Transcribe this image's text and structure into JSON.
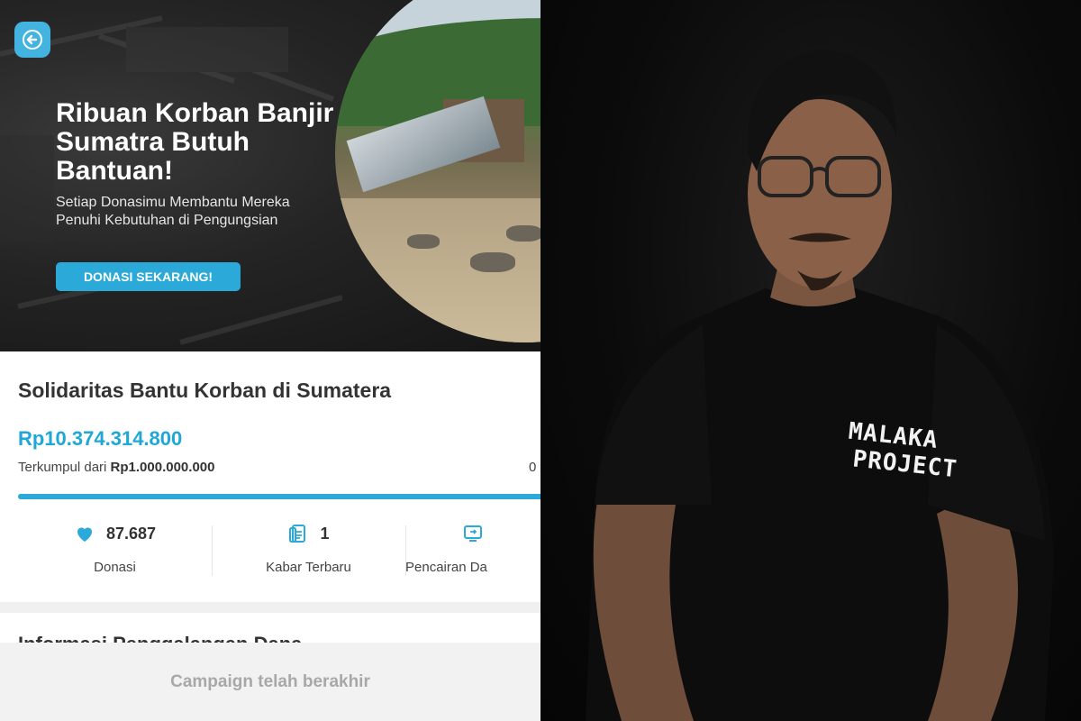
{
  "banner": {
    "headline": "Ribuan Korban Banjir Sumatra Butuh Bantuan!",
    "subline": "Setiap Donasimu Membantu Mereka Penuhi Kebutuhan di Pengungsian",
    "cta_label": "DONASI SEKARANG!"
  },
  "campaign": {
    "title": "Solidaritas Bantu Korban di Sumatera",
    "amount": "Rp10.374.314.800",
    "collected_prefix": "Terkumpul dari",
    "collected_target": "Rp1.000.000.000",
    "percent_partial": "0",
    "progress_fraction": 1.0
  },
  "stats": [
    {
      "icon": "heart-icon",
      "value": "87.687",
      "label": "Donasi"
    },
    {
      "icon": "news-icon",
      "value": "1",
      "label": "Kabar Terbaru"
    },
    {
      "icon": "withdrawal-icon",
      "value": "",
      "label": "Pencairan Da"
    }
  ],
  "section_partial_title": "Informasi Penggalangan Dana",
  "footer": {
    "status": "Campaign telah berakhir"
  },
  "photo": {
    "shirt_logo_line1": "MALAKA",
    "shirt_logo_line2": "PROJECT"
  },
  "colors": {
    "accent": "#2ba9d8",
    "back_button": "#43b3e0",
    "footer_bg": "#f2f2f2"
  }
}
